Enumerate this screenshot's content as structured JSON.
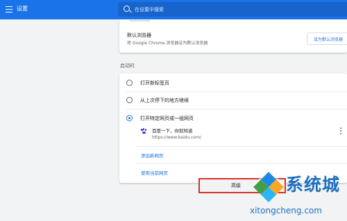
{
  "header": {
    "title": "设置",
    "menu_icon": "hamburger-menu-icon",
    "search_icon": "search-icon",
    "search_placeholder": "在设置中搜索",
    "bg_color": "#1a73e8"
  },
  "default_browser": {
    "title": "默认浏览器",
    "subtitle": "将 Google Chrome 浏览器设为默认浏览器",
    "button_label": "设为默认浏览器"
  },
  "startup": {
    "section_title": "启动时",
    "options": [
      {
        "label": "打开新标签页",
        "checked": false
      },
      {
        "label": "从上次停下的地方继续",
        "checked": false
      },
      {
        "label": "打开特定网页或一组网页",
        "checked": true
      }
    ],
    "pages": [
      {
        "title": "百度一下，你就知道",
        "url": "https://www.baidu.com/",
        "icon": "baidu-paw-icon"
      }
    ],
    "add_page_link": "添加新网页",
    "use_current_link": "使用当前网页"
  },
  "advanced": {
    "label": "高级",
    "icon": "chevron-down-icon",
    "highlight_color": "#d93025"
  },
  "watermark": {
    "name": "系统城",
    "url": "xitongcheng.com",
    "color": "#1e6fc0"
  }
}
